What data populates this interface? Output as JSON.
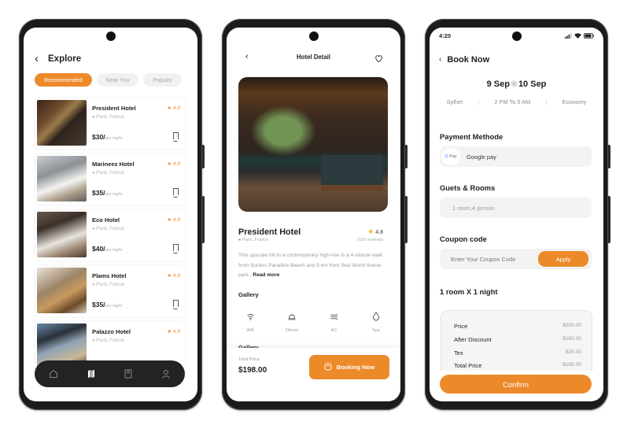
{
  "colors": {
    "accent": "#ec8a2a",
    "dark_nav": "#232323",
    "star": "#ec8a2a"
  },
  "explore": {
    "title": "Explore",
    "back_icon": "chevron-left-icon",
    "filters": [
      {
        "label": "Recommended",
        "active": true
      },
      {
        "label": "Near You",
        "active": false
      },
      {
        "label": "Populor",
        "active": false
      }
    ],
    "hotels": [
      {
        "name": "President Hotel",
        "location": "Paris, France",
        "rating": "4.9",
        "price": "$30/",
        "unit": "per night"
      },
      {
        "name": "Marineez Hotel",
        "location": "Paris, France",
        "rating": "4.9",
        "price": "$35/",
        "unit": "per night"
      },
      {
        "name": "Eco Hotel",
        "location": "Paris, France",
        "rating": "4.9",
        "price": "$40/",
        "unit": "per night"
      },
      {
        "name": "Plams Hotel",
        "location": "Paris, France",
        "rating": "4.9",
        "price": "$35/",
        "unit": "per night"
      },
      {
        "name": "Palazzo Hotel",
        "location": "Paris, France",
        "rating": "4.9",
        "price": "",
        "unit": ""
      }
    ],
    "bottom_nav": [
      "home-icon",
      "map-icon",
      "bookmark-icon",
      "profile-icon"
    ],
    "bottom_nav_active": "map-icon"
  },
  "detail": {
    "title": "Hotel Detail",
    "hotel_name": "President Hotel",
    "rating": "4.8",
    "location": "Paris, France",
    "reviews": "(150 reviews)",
    "description": "This upscale hill in a contemporary high-rise is a 4-minute walk from Surfers Paradise Beach and 5 km from Sea World theme park...",
    "read_more": "Read more",
    "gallery_label": "Gallery",
    "amenities": [
      {
        "icon": "wifi-icon",
        "label": "Wifi"
      },
      {
        "icon": "dinner-icon",
        "label": "Dinner"
      },
      {
        "icon": "ac-icon",
        "label": "AC"
      },
      {
        "icon": "spa-icon",
        "label": "Spa"
      }
    ],
    "gallery_label_2": "Gallery",
    "total_price_label": "Total Price",
    "total_price": "$198.00",
    "booking_button": "Booking Now"
  },
  "book": {
    "status_time": "4:20",
    "title": "Book Now",
    "date_from": "9 Sep",
    "date_to": "10 Sep",
    "location": "Sylhet",
    "time_range": "2 PM To 5 AM",
    "class": "Economy",
    "payment_title": "Payment Methode",
    "payment_badge": "G Pay",
    "payment_value": "Google pay",
    "guests_title": "Guets & Rooms",
    "guests_value": "1 room,4 person",
    "coupon_title": "Coupon code",
    "coupon_placeholder": "Enter Your Coupon Code",
    "apply_button": "Apply",
    "stay_title": "1 room X 1 night",
    "summary": [
      {
        "label": "Price",
        "value": "$200.00"
      },
      {
        "label": "After Discount",
        "value": "$160.00"
      },
      {
        "label": "Tex",
        "value": "$25.00"
      },
      {
        "label": "Total Price",
        "value": "$185.00"
      }
    ],
    "confirm_button": "Confirm"
  }
}
